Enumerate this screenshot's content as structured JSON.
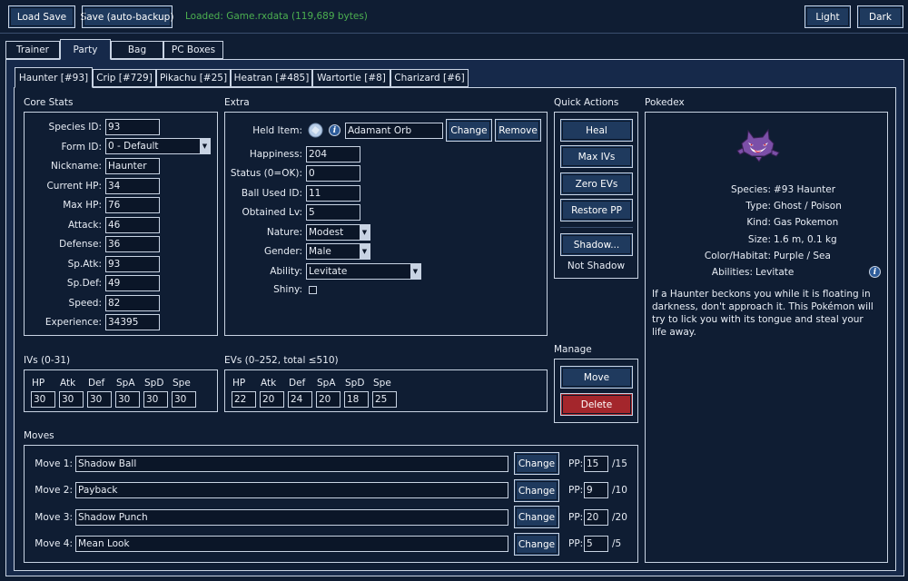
{
  "toolbar": {
    "load_label": "Load Save",
    "save_label": "Save (auto-backup)",
    "status": "Loaded: Game.rxdata  (119,689 bytes)",
    "light_label": "Light",
    "dark_label": "Dark"
  },
  "main_tabs": [
    "Trainer",
    "Party",
    "Bag",
    "PC Boxes"
  ],
  "party_tabs": [
    "Haunter [#93]",
    "Crip [#729]",
    "Pikachu [#25]",
    "Heatran [#485]",
    "Wartortle [#8]",
    "Charizard [#6]"
  ],
  "core": {
    "title": "Core Stats",
    "rows": [
      {
        "label": "Species ID:",
        "value": "93"
      },
      {
        "label": "Form ID:",
        "value": "0 - Default"
      },
      {
        "label": "Nickname:",
        "value": "Haunter"
      },
      {
        "label": "Current HP:",
        "value": "34"
      },
      {
        "label": "Max HP:",
        "value": "76"
      },
      {
        "label": "Attack:",
        "value": "46"
      },
      {
        "label": "Defense:",
        "value": "36"
      },
      {
        "label": "Sp.Atk:",
        "value": "93"
      },
      {
        "label": "Sp.Def:",
        "value": "49"
      },
      {
        "label": "Speed:",
        "value": "82"
      },
      {
        "label": "Experience:",
        "value": "34395"
      }
    ]
  },
  "extra": {
    "title": "Extra",
    "held_label": "Held Item:",
    "held_value": "Adamant Orb",
    "change_label": "Change",
    "remove_label": "Remove",
    "rows": [
      {
        "label": "Happiness:",
        "value": "204"
      },
      {
        "label": "Status (0=OK):",
        "value": "0"
      },
      {
        "label": "Ball Used ID:",
        "value": "11"
      },
      {
        "label": "Obtained Lv:",
        "value": "5"
      },
      {
        "label": "Nature:",
        "value": "Modest"
      },
      {
        "label": "Gender:",
        "value": "Male"
      },
      {
        "label": "Ability:",
        "value": "Levitate"
      }
    ],
    "shiny_label": "Shiny:"
  },
  "quick": {
    "title": "Quick Actions",
    "heal": "Heal",
    "max_ivs": "Max IVs",
    "zero_evs": "Zero EVs",
    "restore_pp": "Restore PP",
    "shadow": "Shadow...",
    "shadow_status": "Not Shadow"
  },
  "manage": {
    "title": "Manage",
    "move": "Move",
    "delete": "Delete"
  },
  "ivs": {
    "title": "IVs  (0-31)",
    "labels": [
      "HP",
      "Atk",
      "Def",
      "SpA",
      "SpD",
      "Spe"
    ],
    "values": [
      "30",
      "30",
      "30",
      "30",
      "30",
      "30"
    ]
  },
  "evs": {
    "title": "EVs  (0–252, total ≤510)",
    "labels": [
      "HP",
      "Atk",
      "Def",
      "SpA",
      "SpD",
      "Spe"
    ],
    "values": [
      "22",
      "20",
      "24",
      "20",
      "18",
      "25"
    ]
  },
  "pokedex": {
    "title": "Pokedex",
    "rows": [
      {
        "label": "Species:",
        "value": "#93 Haunter"
      },
      {
        "label": "Type:",
        "value": "Ghost / Poison"
      },
      {
        "label": "Kind:",
        "value": "Gas Pokemon"
      },
      {
        "label": "Size:",
        "value": "1.6 m, 0.1 kg"
      },
      {
        "label": "Color/Habitat:",
        "value": "Purple / Sea"
      },
      {
        "label": "Abilities:",
        "value": "Levitate"
      }
    ],
    "description": "If a Haunter beckons you while it is floating in darkness, don't approach it. This Pokémon will try to lick you with its tongue and steal your life away."
  },
  "moves": {
    "title": "Moves",
    "change_label": "Change",
    "pp_label": "PP:",
    "rows": [
      {
        "label": "Move 1:",
        "name": "Shadow Ball",
        "pp": "15",
        "max": "/15"
      },
      {
        "label": "Move 2:",
        "name": "Payback",
        "pp": "9",
        "max": "/10"
      },
      {
        "label": "Move 3:",
        "name": "Shadow Punch",
        "pp": "20",
        "max": "/20"
      },
      {
        "label": "Move 4:",
        "name": "Mean Look",
        "pp": "5",
        "max": "/5"
      }
    ]
  },
  "colors": {
    "background": "#0f1d33",
    "button": "#1f3a5e",
    "danger": "#a4262c",
    "status_text": "#4caf50"
  },
  "icons": {
    "held_item": "orb-icon",
    "info": "info-icon",
    "sprite": "haunter-sprite"
  }
}
